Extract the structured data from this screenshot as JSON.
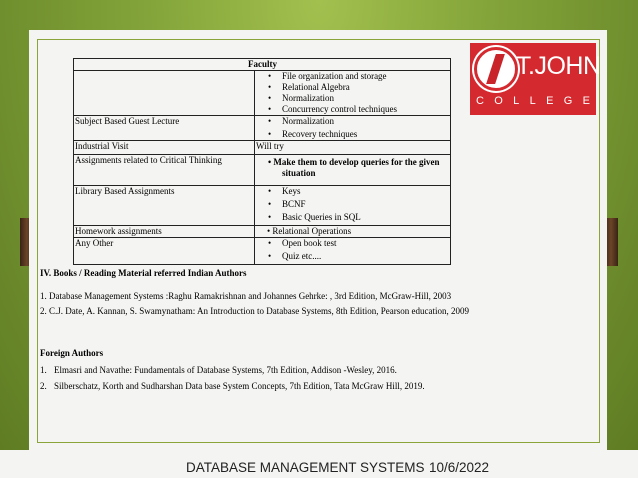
{
  "table": {
    "header": "Faculty",
    "rows": [
      {
        "label": "",
        "items": [
          "File organization and storage",
          "Relational Algebra",
          "Normalization",
          "Concurrency control techniques"
        ]
      },
      {
        "label": "Subject Based Guest Lecture",
        "items": [
          "Normalization",
          "Recovery techniques"
        ]
      },
      {
        "label": "Industrial Visit",
        "text": "Will try"
      },
      {
        "label": "Assignments related to Critical Thinking",
        "bold_bullet": "• Make them to develop queries for the given",
        "bold_cont": "situation"
      },
      {
        "label": "Library Based Assignments",
        "items": [
          "Keys",
          "BCNF",
          "Basic Queries in SQL"
        ]
      },
      {
        "label": "Homework assignments",
        "text": "• Relational Operations"
      },
      {
        "label": "Any Other",
        "items": [
          "Open book test",
          "Quiz etc...."
        ]
      }
    ]
  },
  "books": {
    "heading": "IV. Books / Reading Material referred Indian Authors",
    "indian": [
      "1. Database Management Systems :Raghu Ramakrishnan and Johannes Gehrke: , 3rd Edition, McGraw-Hill, 2003",
      "2. C.J. Date, A. Kannan, S. Swamynatham: An Introduction to Database Systems, 8th Edition, Pearson education, 2009"
    ],
    "foreign_heading": "Foreign Authors",
    "foreign": [
      {
        "num": "1.",
        "text": "Elmasri and Navathe: Fundamentals of Database Systems, 7th Edition, Addison -Wesley, 2016."
      },
      {
        "num": "2.",
        "text": "Silberschatz, Korth and Sudharshan Data base System Concepts, 7th Edition, Tata McGraw Hill, 2019."
      }
    ]
  },
  "logo": {
    "name": "T.JOHN",
    "college_letters": [
      "C",
      "O",
      "L",
      "L",
      "E",
      "G",
      "E"
    ]
  },
  "footer": {
    "title": "DATABASE MANAGEMENT SYSTEMS",
    "date": "10/6/2022"
  },
  "colors": {
    "background": "#7c9c34",
    "logo_red": "#d42a2f",
    "frame": "#8aa43a"
  }
}
